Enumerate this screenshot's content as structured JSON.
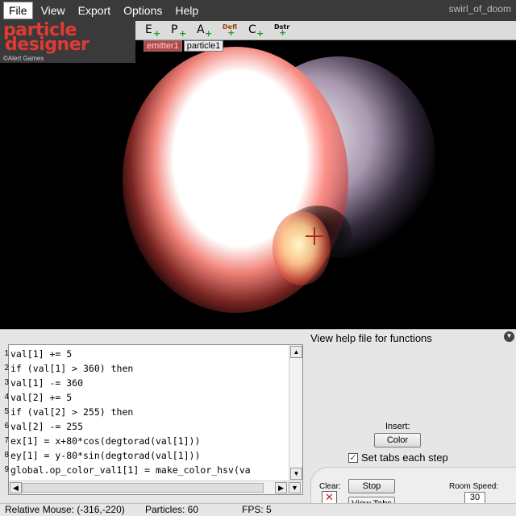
{
  "window": {
    "title": "swirl_of_doom"
  },
  "menu": [
    "File",
    "View",
    "Export",
    "Options",
    "Help"
  ],
  "logo": {
    "line1": "particle",
    "line2": "designer",
    "credit": "©Alert Games"
  },
  "toolbar": {
    "buttons": [
      {
        "label": "E",
        "icon": "add-emitter-icon"
      },
      {
        "label": "P",
        "icon": "add-particle-icon"
      },
      {
        "label": "A",
        "icon": "add-attractor-icon"
      },
      {
        "label": "Defl",
        "icon": "add-deflector-icon"
      },
      {
        "label": "C",
        "icon": "add-changer-icon"
      },
      {
        "label": "Dstr",
        "icon": "add-destroyer-icon"
      }
    ]
  },
  "tabs": [
    "emitter1",
    "particle1"
  ],
  "canvas": {
    "crosshair_color": "#b0241e"
  },
  "editor": {
    "line_numbers": [
      "1",
      "2",
      "3",
      "4",
      "5",
      "6",
      "7",
      "8",
      "9"
    ],
    "lines": [
      "val[1] += 5",
      "if (val[1] > 360) then",
      "val[1] -= 360",
      "val[2] += 5",
      "if (val[2] > 255) then",
      "val[2] -= 255",
      "ex[1] = x+80*cos(degtorad(val[1]))",
      "ey[1] = y-80*sin(degtorad(val[1]))",
      "global.op_color_val1[1] = make_color_hsv(va"
    ]
  },
  "panel": {
    "help_text": "View help file for functions",
    "insert_label": "Insert:",
    "color_button": "Color",
    "set_tabs_label": "Set tabs each step",
    "set_tabs_checked": true,
    "clear_label": "Clear:",
    "stop_button": "Stop",
    "view_tabs_button": "View Tabs",
    "room_speed_label": "Room Speed:",
    "room_speed_value": "30"
  },
  "status": {
    "mouse": "Relative Mouse: (-316,-220)",
    "particles": "Particles: 60",
    "fps": "FPS: 5"
  }
}
